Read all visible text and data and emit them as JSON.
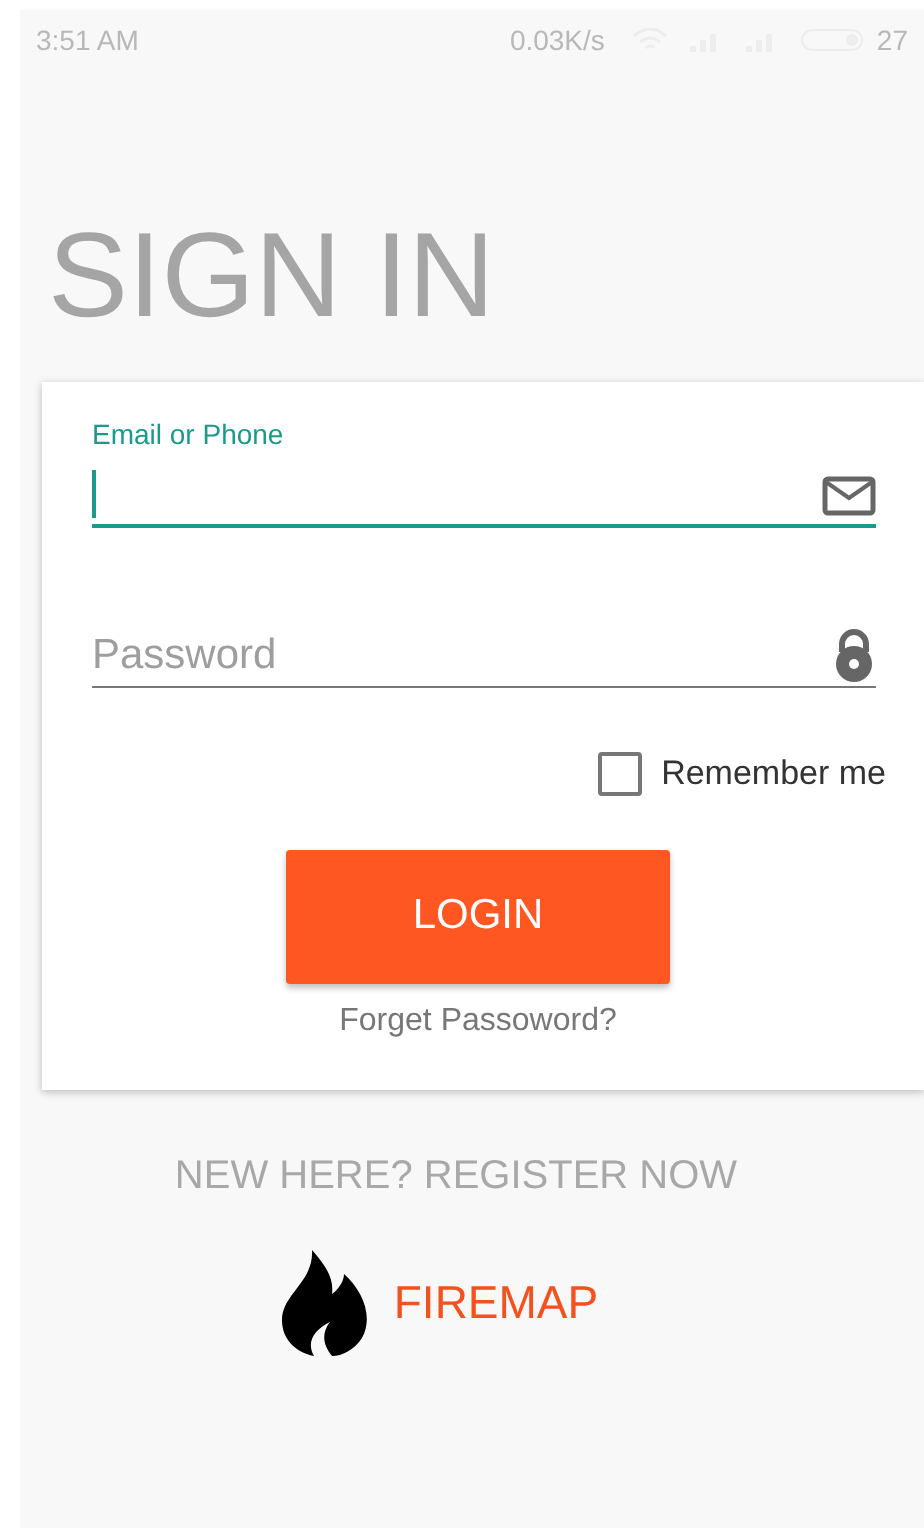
{
  "status_bar": {
    "time": "3:51 AM",
    "speed": "0.03K/s",
    "battery": "27"
  },
  "title": "SIGN IN",
  "form": {
    "email": {
      "label": "Email or Phone",
      "focused": true
    },
    "password": {
      "placeholder": "Password",
      "focused": false
    },
    "remember": {
      "label": "Remember me",
      "checked": false
    },
    "login_button": "LOGIN",
    "forgot_link": "Forget Passoword?"
  },
  "register_link": "NEW HERE? REGISTER NOW",
  "brand": "FIREMAP"
}
